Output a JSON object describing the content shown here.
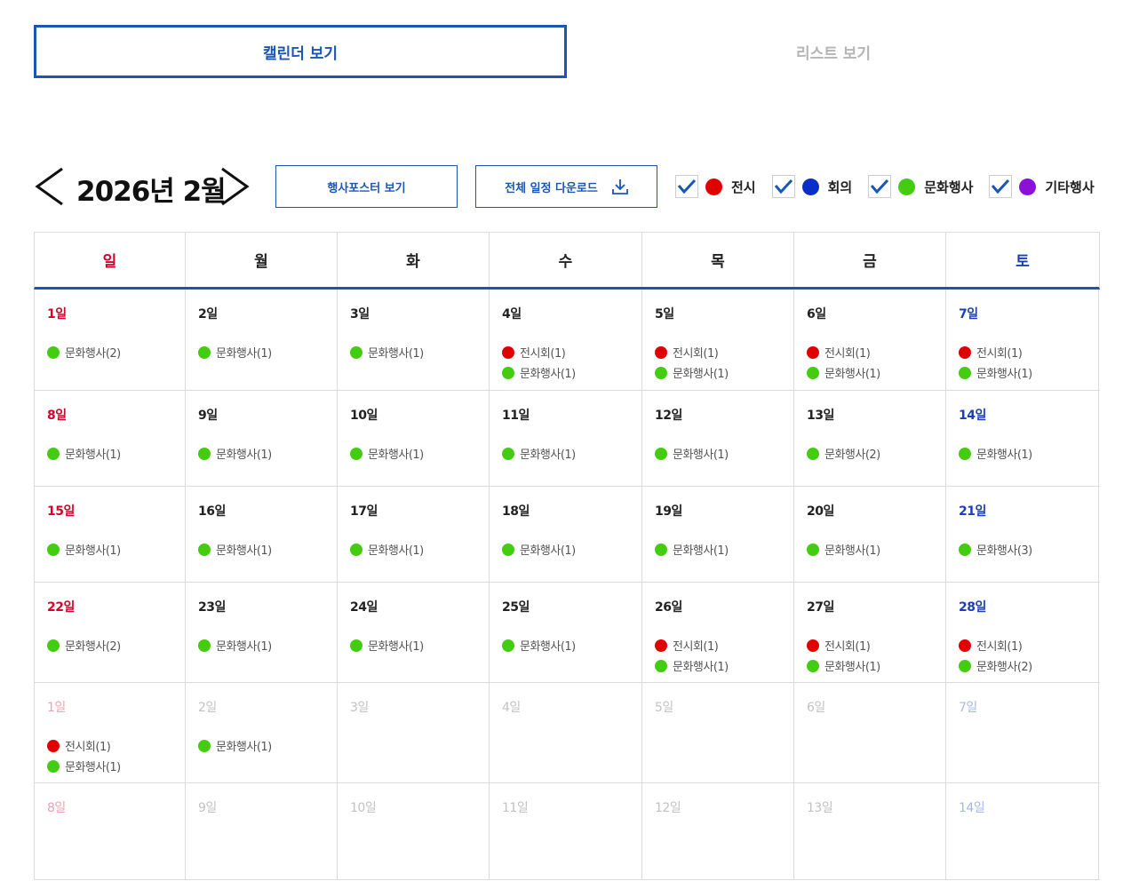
{
  "view_tabs": {
    "calendar": "캘린더 보기",
    "list": "리스트 보기"
  },
  "toolbar": {
    "month_title": "2026년 2월",
    "poster_button": "행사포스터 보기",
    "download_button": "전체 일정 다운로드"
  },
  "colors": {
    "accent": "#1a56b8",
    "exhibition": "#e00000",
    "meeting": "#0a2fc8",
    "culture": "#44cc11",
    "other": "#8a12d8",
    "sunday": "#d4002a",
    "saturday": "#1a3fb8"
  },
  "filters": [
    {
      "label": "전시",
      "type": "exhibition",
      "checked": true
    },
    {
      "label": "회의",
      "type": "meeting",
      "checked": true
    },
    {
      "label": "문화행사",
      "type": "culture",
      "checked": true
    },
    {
      "label": "기타행사",
      "type": "other",
      "checked": true
    }
  ],
  "weekdays": [
    "일",
    "월",
    "화",
    "수",
    "목",
    "금",
    "토"
  ],
  "weeks": [
    [
      {
        "label": "1일",
        "events": [
          {
            "type": "culture",
            "text": "문화행사(2)"
          }
        ]
      },
      {
        "label": "2일",
        "events": [
          {
            "type": "culture",
            "text": "문화행사(1)"
          }
        ]
      },
      {
        "label": "3일",
        "events": [
          {
            "type": "culture",
            "text": "문화행사(1)"
          }
        ]
      },
      {
        "label": "4일",
        "events": [
          {
            "type": "exhibition",
            "text": "전시회(1)"
          },
          {
            "type": "culture",
            "text": "문화행사(1)"
          }
        ]
      },
      {
        "label": "5일",
        "events": [
          {
            "type": "exhibition",
            "text": "전시회(1)"
          },
          {
            "type": "culture",
            "text": "문화행사(1)"
          }
        ]
      },
      {
        "label": "6일",
        "events": [
          {
            "type": "exhibition",
            "text": "전시회(1)"
          },
          {
            "type": "culture",
            "text": "문화행사(1)"
          }
        ]
      },
      {
        "label": "7일",
        "events": [
          {
            "type": "exhibition",
            "text": "전시회(1)"
          },
          {
            "type": "culture",
            "text": "문화행사(1)"
          }
        ]
      }
    ],
    [
      {
        "label": "8일",
        "events": [
          {
            "type": "culture",
            "text": "문화행사(1)"
          }
        ]
      },
      {
        "label": "9일",
        "events": [
          {
            "type": "culture",
            "text": "문화행사(1)"
          }
        ]
      },
      {
        "label": "10일",
        "events": [
          {
            "type": "culture",
            "text": "문화행사(1)"
          }
        ]
      },
      {
        "label": "11일",
        "events": [
          {
            "type": "culture",
            "text": "문화행사(1)"
          }
        ]
      },
      {
        "label": "12일",
        "events": [
          {
            "type": "culture",
            "text": "문화행사(1)"
          }
        ]
      },
      {
        "label": "13일",
        "events": [
          {
            "type": "culture",
            "text": "문화행사(2)"
          }
        ]
      },
      {
        "label": "14일",
        "events": [
          {
            "type": "culture",
            "text": "문화행사(1)"
          }
        ]
      }
    ],
    [
      {
        "label": "15일",
        "events": [
          {
            "type": "culture",
            "text": "문화행사(1)"
          }
        ]
      },
      {
        "label": "16일",
        "events": [
          {
            "type": "culture",
            "text": "문화행사(1)"
          }
        ]
      },
      {
        "label": "17일",
        "events": [
          {
            "type": "culture",
            "text": "문화행사(1)"
          }
        ]
      },
      {
        "label": "18일",
        "events": [
          {
            "type": "culture",
            "text": "문화행사(1)"
          }
        ]
      },
      {
        "label": "19일",
        "events": [
          {
            "type": "culture",
            "text": "문화행사(1)"
          }
        ]
      },
      {
        "label": "20일",
        "events": [
          {
            "type": "culture",
            "text": "문화행사(1)"
          }
        ]
      },
      {
        "label": "21일",
        "events": [
          {
            "type": "culture",
            "text": "문화행사(3)"
          }
        ]
      }
    ],
    [
      {
        "label": "22일",
        "events": [
          {
            "type": "culture",
            "text": "문화행사(2)"
          }
        ]
      },
      {
        "label": "23일",
        "events": [
          {
            "type": "culture",
            "text": "문화행사(1)"
          }
        ]
      },
      {
        "label": "24일",
        "events": [
          {
            "type": "culture",
            "text": "문화행사(1)"
          }
        ]
      },
      {
        "label": "25일",
        "events": [
          {
            "type": "culture",
            "text": "문화행사(1)"
          }
        ]
      },
      {
        "label": "26일",
        "events": [
          {
            "type": "exhibition",
            "text": "전시회(1)"
          },
          {
            "type": "culture",
            "text": "문화행사(1)"
          }
        ]
      },
      {
        "label": "27일",
        "events": [
          {
            "type": "exhibition",
            "text": "전시회(1)"
          },
          {
            "type": "culture",
            "text": "문화행사(1)"
          }
        ]
      },
      {
        "label": "28일",
        "events": [
          {
            "type": "exhibition",
            "text": "전시회(1)"
          },
          {
            "type": "culture",
            "text": "문화행사(2)"
          }
        ]
      }
    ],
    [
      {
        "label": "1일",
        "other_month": true,
        "events": [
          {
            "type": "exhibition",
            "text": "전시회(1)"
          },
          {
            "type": "culture",
            "text": "문화행사(1)"
          }
        ]
      },
      {
        "label": "2일",
        "other_month": true,
        "events": [
          {
            "type": "culture",
            "text": "문화행사(1)"
          }
        ]
      },
      {
        "label": "3일",
        "other_month": true,
        "events": []
      },
      {
        "label": "4일",
        "other_month": true,
        "events": []
      },
      {
        "label": "5일",
        "other_month": true,
        "events": []
      },
      {
        "label": "6일",
        "other_month": true,
        "events": []
      },
      {
        "label": "7일",
        "other_month": true,
        "events": []
      }
    ],
    [
      {
        "label": "8일",
        "other_month": true,
        "events": []
      },
      {
        "label": "9일",
        "other_month": true,
        "events": []
      },
      {
        "label": "10일",
        "other_month": true,
        "events": []
      },
      {
        "label": "11일",
        "other_month": true,
        "events": []
      },
      {
        "label": "12일",
        "other_month": true,
        "events": []
      },
      {
        "label": "13일",
        "other_month": true,
        "events": []
      },
      {
        "label": "14일",
        "other_month": true,
        "events": []
      }
    ]
  ]
}
